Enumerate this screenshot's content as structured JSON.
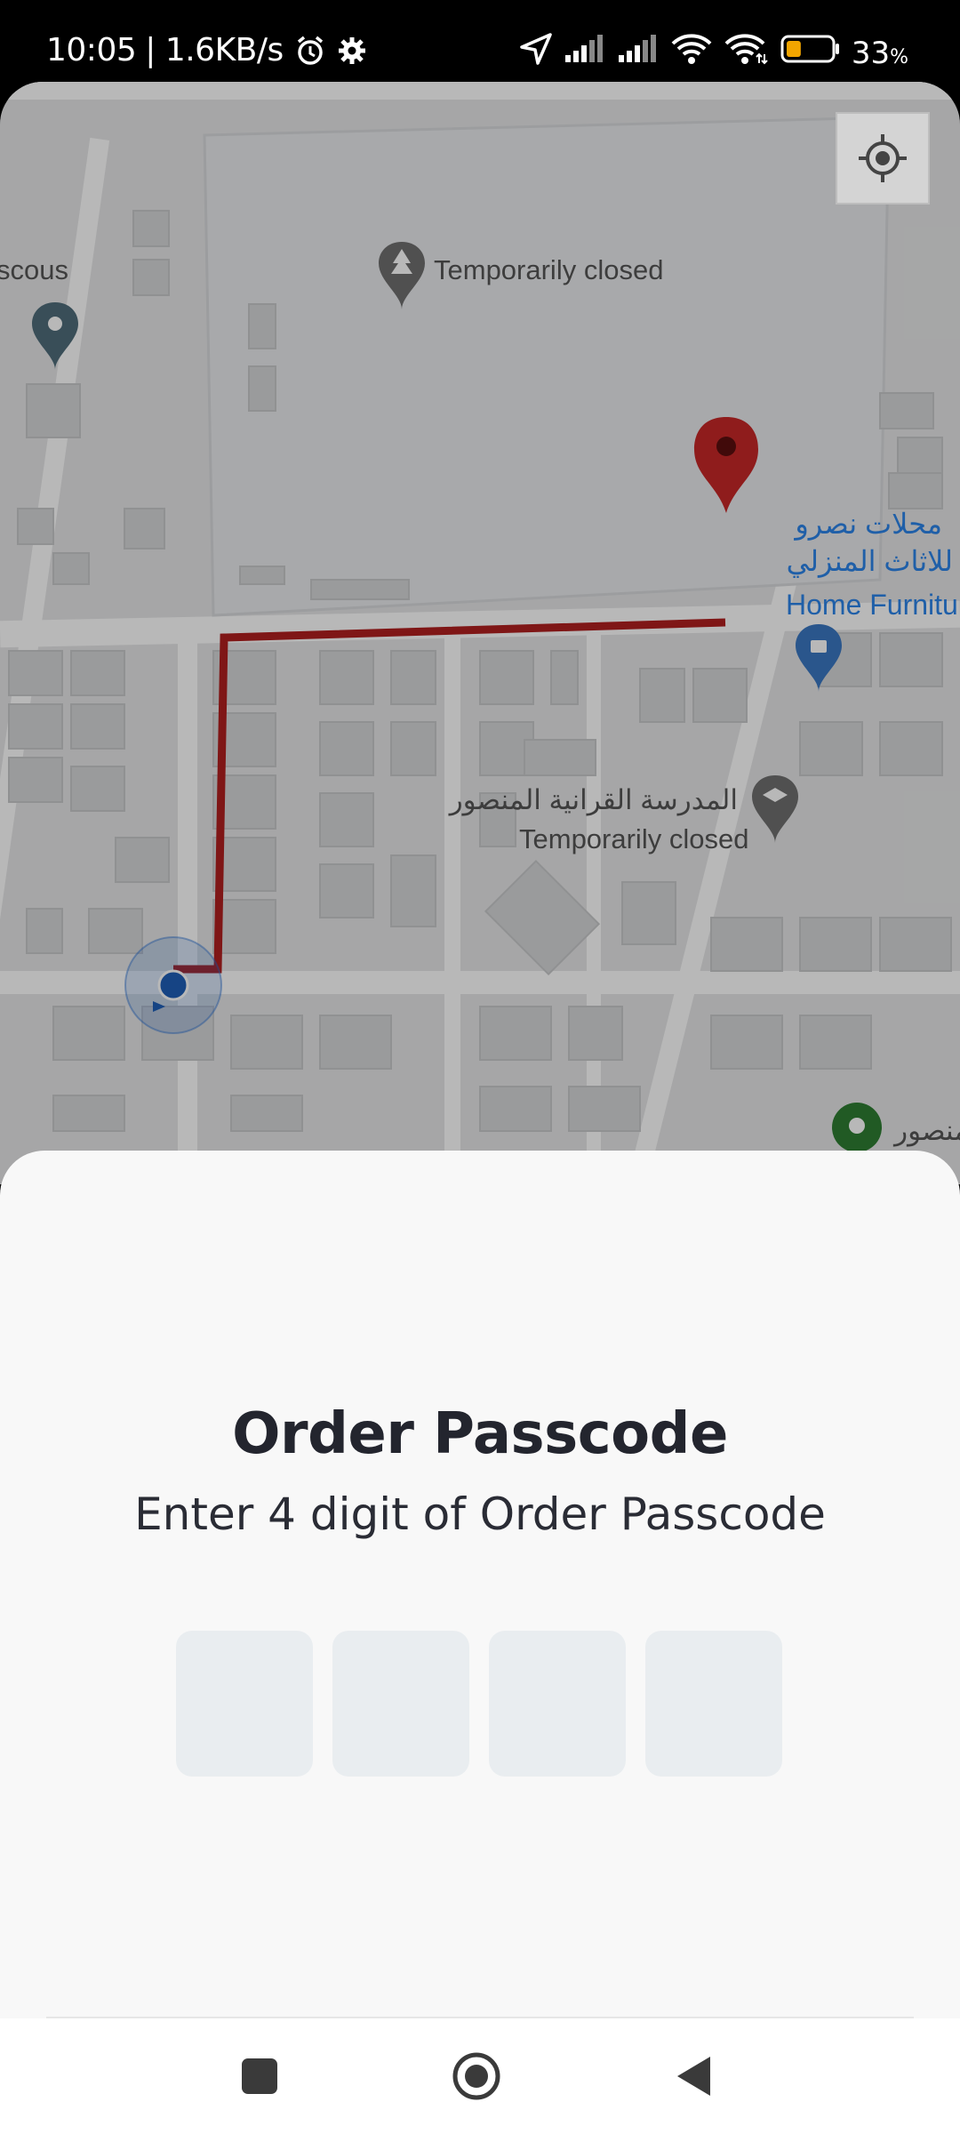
{
  "status_bar": {
    "time": "10:05",
    "network_speed": "| 1.6KB/s",
    "battery_percent": "33",
    "battery_unit": "%",
    "battery_level": 0.33,
    "icons": [
      "alarm-icon",
      "gear-icon",
      "location-arrow-icon",
      "signal-icon",
      "signal-icon",
      "wifi-icon",
      "wifi-icon",
      "battery-icon"
    ]
  },
  "map": {
    "labels": {
      "park_closed": "Temporarily closed",
      "left_edge_place": "scous",
      "store_ar_line1": "محلات نصرو",
      "store_ar_line2": "للاثاث المنزلي",
      "store_en": "Home Furniture",
      "school_ar": "المدرسة القرانية المنصور",
      "school_closed": "Temporarily closed",
      "bottom_edge_place": "منصور"
    },
    "colors": {
      "route": "#b01f1f",
      "destination_pin": "#c62828",
      "user_dot": "#1f5fb8",
      "shop_pin": "#3b78c3",
      "green_pin": "#2e7d32"
    }
  },
  "sheet": {
    "title": "Order Passcode",
    "subtitle": "Enter 4 digit of Order Passcode",
    "code_digits": [
      "",
      "",
      "",
      ""
    ]
  },
  "nav_bar": {
    "buttons": [
      "recents-button",
      "home-button",
      "back-button"
    ]
  }
}
